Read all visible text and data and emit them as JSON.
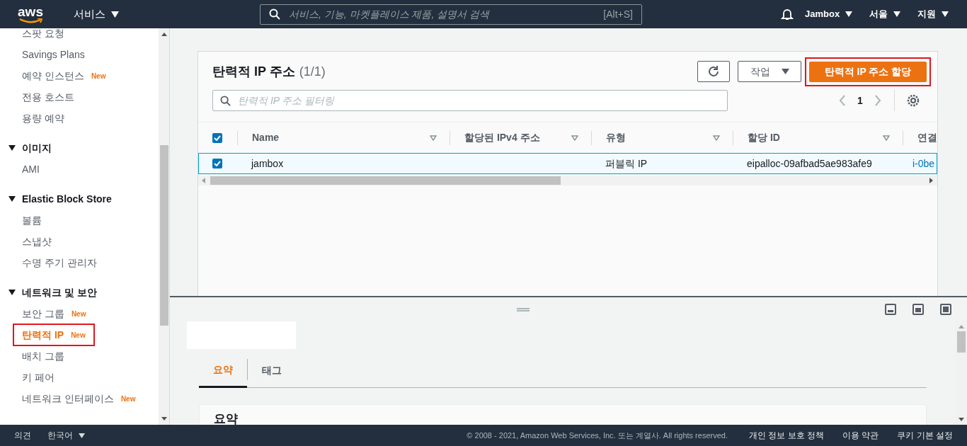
{
  "nav": {
    "logo": "aws",
    "services": "서비스",
    "search_placeholder": "서비스, 기능, 마켓플레이스 제품, 설명서 검색",
    "shortcut": "[Alt+S]",
    "account": "Jambox",
    "region": "서울",
    "support": "지원"
  },
  "sidebar": {
    "items": [
      {
        "kind": "item",
        "label": "스팟 요청",
        "selected": false
      },
      {
        "kind": "item",
        "label": "Savings Plans",
        "selected": false
      },
      {
        "kind": "item",
        "label": "예약 인스턴스",
        "badge": "New",
        "selected": false
      },
      {
        "kind": "item",
        "label": "전용 호스트",
        "selected": false
      },
      {
        "kind": "item",
        "label": "용량 예약",
        "selected": false
      },
      {
        "kind": "section",
        "label": "이미지",
        "expanded": true
      },
      {
        "kind": "item",
        "label": "AMI",
        "selected": false
      },
      {
        "kind": "section",
        "label": "Elastic Block Store",
        "expanded": true
      },
      {
        "kind": "item",
        "label": "볼륨",
        "selected": false
      },
      {
        "kind": "item",
        "label": "스냅샷",
        "selected": false
      },
      {
        "kind": "item",
        "label": "수명 주기 관리자",
        "selected": false
      },
      {
        "kind": "section",
        "label": "네트워크 및 보안",
        "expanded": true
      },
      {
        "kind": "item",
        "label": "보안 그룹",
        "badge": "New",
        "selected": false
      },
      {
        "kind": "item",
        "label": "탄력적 IP",
        "badge": "New",
        "selected": true,
        "highlighted": true
      },
      {
        "kind": "item",
        "label": "배치 그룹",
        "selected": false
      },
      {
        "kind": "item",
        "label": "키 페어",
        "selected": false
      },
      {
        "kind": "item",
        "label": "네트워크 인터페이스",
        "badge": "New",
        "selected": false
      }
    ]
  },
  "panel": {
    "title": "탄력적 IP 주소",
    "count": "(1/1)",
    "actions": "작업",
    "primary": {
      "label": "탄력적 IP 주소 할당",
      "highlighted": true
    },
    "filter_placeholder": "탄력적 IP 주소 필터링",
    "page": "1"
  },
  "table": {
    "select_all": true,
    "columns": [
      {
        "label": "Name",
        "sortable": true
      },
      {
        "label": "할당된 IPv4 주소",
        "sortable": true
      },
      {
        "label": "유형",
        "sortable": true
      },
      {
        "label": "할당 ID",
        "sortable": true
      },
      {
        "label": "연결",
        "sortable": false
      }
    ],
    "rows": [
      {
        "selected": true,
        "name": "jambox",
        "type": "퍼블릭 IP",
        "allocation_id": "eipalloc-09afbad5ae983afe9",
        "instance": "i-0be"
      }
    ]
  },
  "details": {
    "tabs": [
      {
        "label": "요약",
        "selected": true
      },
      {
        "label": "태그",
        "selected": false
      }
    ],
    "card_title": "요약"
  },
  "footer": {
    "feedback": "의견",
    "language": "한국어",
    "copyright": "© 2008 - 2021, Amazon Web Services, Inc. 또는 계열사. All rights reserved.",
    "links": [
      "개인 정보 보호 정책",
      "이용 약관",
      "쿠키 기본 설정"
    ]
  }
}
